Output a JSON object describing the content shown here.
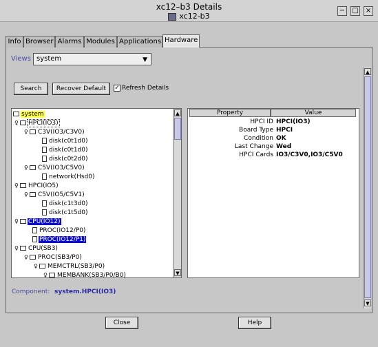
{
  "window": {
    "title": "xc12–b3 Details",
    "subtitle": "xc12-b3",
    "controls": [
      "−",
      "□",
      "×"
    ]
  },
  "tabs": [
    "Info",
    "Browser",
    "Alarms",
    "Modules",
    "Applications",
    "Hardware"
  ],
  "active_tab": "Hardware",
  "views": {
    "label": "Views",
    "selected": "system"
  },
  "toolbar": {
    "search": "Search",
    "recover_default": "Recover Default",
    "refresh_checkbox": "Refresh Details",
    "refresh_checked_mark": "✓"
  },
  "tree": [
    {
      "label": "system",
      "style": "sel-yellow",
      "icon": "folder"
    },
    {
      "label": "HPCI(IO3)",
      "style": "outline",
      "icon": "folder"
    },
    {
      "label": "C3V(IO3/C3V0)",
      "style": "",
      "icon": "folder"
    },
    {
      "label": "disk(c0t1d0)",
      "style": "",
      "icon": "doc"
    },
    {
      "label": "disk(c0t1d0)",
      "style": "",
      "icon": "doc"
    },
    {
      "label": "disk(c0t2d0)",
      "style": "",
      "icon": "doc"
    },
    {
      "label": "C5V(IO3/C5V0)",
      "style": "",
      "icon": "folder"
    },
    {
      "label": "network(Hsd0)",
      "style": "",
      "icon": "doc"
    },
    {
      "label": "HPCI(IO5)",
      "style": "",
      "icon": "folder"
    },
    {
      "label": "C5V(IO5/C5V1)",
      "style": "",
      "icon": "folder"
    },
    {
      "label": "disk(c1t3d0)",
      "style": "",
      "icon": "doc"
    },
    {
      "label": "disk(c1t5d0)",
      "style": "",
      "icon": "doc"
    },
    {
      "label": "CPU(IO12)",
      "style": "sel-blue",
      "icon": "folder"
    },
    {
      "label": "PROC(IO12/P0)",
      "style": "",
      "icon": "doc"
    },
    {
      "label": "PROC(IO12/P1)",
      "style": "sel-blue",
      "icon": "doc"
    },
    {
      "label": "CPU(SB3)",
      "style": "",
      "icon": "folder"
    },
    {
      "label": "PROC(SB3/P0)",
      "style": "",
      "icon": "folder"
    },
    {
      "label": "MEMCTRL(SB3/P0)",
      "style": "",
      "icon": "folder"
    },
    {
      "label": "MEMBANK(SB3/P0/B0)",
      "style": "",
      "icon": "folder"
    }
  ],
  "properties": {
    "header_property": "Property",
    "header_value": "Value",
    "rows": [
      {
        "property": "HPCI ID",
        "value": "HPCI(IO3)"
      },
      {
        "property": "Board Type",
        "value": "HPCI"
      },
      {
        "property": "Condition",
        "value": "OK"
      },
      {
        "property": "Last Change",
        "value": "Wed"
      },
      {
        "property": "HPCI Cards",
        "value": "IO3/C3V0,IO3/C5V0"
      }
    ]
  },
  "component": {
    "label": "Component:",
    "value": "system.HPCI(IO3)"
  },
  "footer": {
    "close": "Close",
    "help": "Help"
  }
}
